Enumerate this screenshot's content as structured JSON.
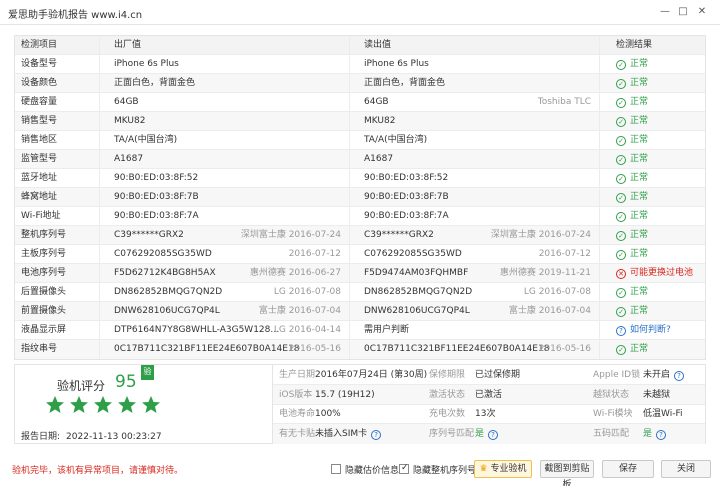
{
  "window": {
    "title": "爱思助手验机报告 www.i4.cn",
    "minimize_icon": "minimize-icon",
    "maximize_icon": "maximize-icon",
    "close_icon": "close-icon"
  },
  "table": {
    "headers": [
      "检测项目",
      "出厂值",
      "读出值",
      "检测结果"
    ],
    "rows": [
      {
        "name": "设备型号",
        "factory": "iPhone 6s Plus",
        "factory_note": "",
        "read": "iPhone 6s Plus",
        "read_note": "",
        "result": "正常",
        "status": "ok"
      },
      {
        "name": "设备颜色",
        "factory": "正面白色，背面金色",
        "factory_note": "",
        "read": "正面白色，背面金色",
        "read_note": "",
        "result": "正常",
        "status": "ok"
      },
      {
        "name": "硬盘容量",
        "factory": "64GB",
        "factory_note": "",
        "read": "64GB",
        "read_note": "Toshiba TLC",
        "result": "正常",
        "status": "ok"
      },
      {
        "name": "销售型号",
        "factory": "MKU82",
        "factory_note": "",
        "read": "MKU82",
        "read_note": "",
        "result": "正常",
        "status": "ok"
      },
      {
        "name": "销售地区",
        "factory": "TA/A(中国台湾)",
        "factory_note": "",
        "read": "TA/A(中国台湾)",
        "read_note": "",
        "result": "正常",
        "status": "ok"
      },
      {
        "name": "监管型号",
        "factory": "A1687",
        "factory_note": "",
        "read": "A1687",
        "read_note": "",
        "result": "正常",
        "status": "ok"
      },
      {
        "name": "蓝牙地址",
        "factory": "90:B0:ED:03:8F:52",
        "factory_note": "",
        "read": "90:B0:ED:03:8F:52",
        "read_note": "",
        "result": "正常",
        "status": "ok"
      },
      {
        "name": "蜂窝地址",
        "factory": "90:B0:ED:03:8F:7B",
        "factory_note": "",
        "read": "90:B0:ED:03:8F:7B",
        "read_note": "",
        "result": "正常",
        "status": "ok"
      },
      {
        "name": "Wi-Fi地址",
        "factory": "90:B0:ED:03:8F:7A",
        "factory_note": "",
        "read": "90:B0:ED:03:8F:7A",
        "read_note": "",
        "result": "正常",
        "status": "ok"
      },
      {
        "name": "整机序列号",
        "factory": "C39******GRX2",
        "factory_note": "深圳富士康 2016-07-24",
        "read": "C39******GRX2",
        "read_note": "深圳富士康 2016-07-24",
        "result": "正常",
        "status": "ok"
      },
      {
        "name": "主板序列号",
        "factory": "C076292085SG35WD",
        "factory_note": "2016-07-12",
        "read": "C076292085SG35WD",
        "read_note": "2016-07-12",
        "result": "正常",
        "status": "ok"
      },
      {
        "name": "电池序列号",
        "factory": "F5D62712K4BG8H5AX",
        "factory_note": "惠州德赛 2016-06-27",
        "read": "F5D9474AM03FQHMBF",
        "read_note": "惠州德赛 2019-11-21",
        "result": "可能更换过电池",
        "status": "bad"
      },
      {
        "name": "后置摄像头",
        "factory": "DN862852BMQG7QN2D",
        "factory_note": "LG 2016-07-08",
        "read": "DN862852BMQG7QN2D",
        "read_note": "LG 2016-07-08",
        "result": "正常",
        "status": "ok"
      },
      {
        "name": "前置摄像头",
        "factory": "DNW628106UCG7QP4L",
        "factory_note": "富士康 2016-07-04",
        "read": "DNW628106UCG7QP4L",
        "read_note": "富士康 2016-07-04",
        "result": "正常",
        "status": "ok"
      },
      {
        "name": "液晶显示屏",
        "factory": "DTP6164N7Y8G8WHLL-A3G5W128...",
        "factory_note": "LG 2016-04-14",
        "read": "需用户判断",
        "read_note": "",
        "result": "如何判断?",
        "status": "question"
      },
      {
        "name": "指纹串号",
        "factory": "0C17B711C321BF11EE24E607B0A14E18",
        "factory_note": "2016-05-16",
        "read": "0C17B711C321BF11EE24E607B0A14E18",
        "read_note": "2016-05-16",
        "result": "正常",
        "status": "ok"
      }
    ]
  },
  "summary": {
    "score_label": "验机评分",
    "score": "95",
    "badge": "验",
    "stars": 5,
    "date_label": "报告日期:",
    "date": "2022-11-13 00:23:27",
    "info": [
      [
        {
          "label": "生产日期",
          "value": "2016年07月24日 (第30周)",
          "help": false
        },
        {
          "label": "保修期限",
          "value": "已过保修期",
          "help": false
        },
        {
          "label": "Apple ID锁",
          "value": "未开启",
          "help": true
        }
      ],
      [
        {
          "label": "iOS版本",
          "value": "15.7 (19H12)",
          "help": false
        },
        {
          "label": "激活状态",
          "value": "已激活",
          "help": false
        },
        {
          "label": "越狱状态",
          "value": "未越狱",
          "help": false
        }
      ],
      [
        {
          "label": "电池寿命",
          "value": "100%",
          "help": false
        },
        {
          "label": "充电次数",
          "value": "13次",
          "help": false
        },
        {
          "label": "Wi-Fi模块",
          "value": "低温Wi-Fi",
          "help": false
        }
      ],
      [
        {
          "label": "有无卡贴",
          "value": "未插入SIM卡",
          "help": true
        },
        {
          "label": "序列号匹配",
          "value": "是",
          "help": true
        },
        {
          "label": "五码匹配",
          "value": "是",
          "help": true
        }
      ]
    ]
  },
  "footer": {
    "warning": "验机完毕，该机有异常项目，请谨慎对待。",
    "hide_price_label": "隐藏估价信息",
    "hide_price_checked": false,
    "hide_serial_label": "隐藏整机序列号",
    "hide_serial_checked": true,
    "pro_button": "专业验机",
    "screenshot_button": "截图到剪贴板",
    "save_button": "保存",
    "close_button": "关闭"
  },
  "colors": {
    "ok": "#2e9f48",
    "bad": "#d9261c",
    "link": "#2a71c9"
  }
}
